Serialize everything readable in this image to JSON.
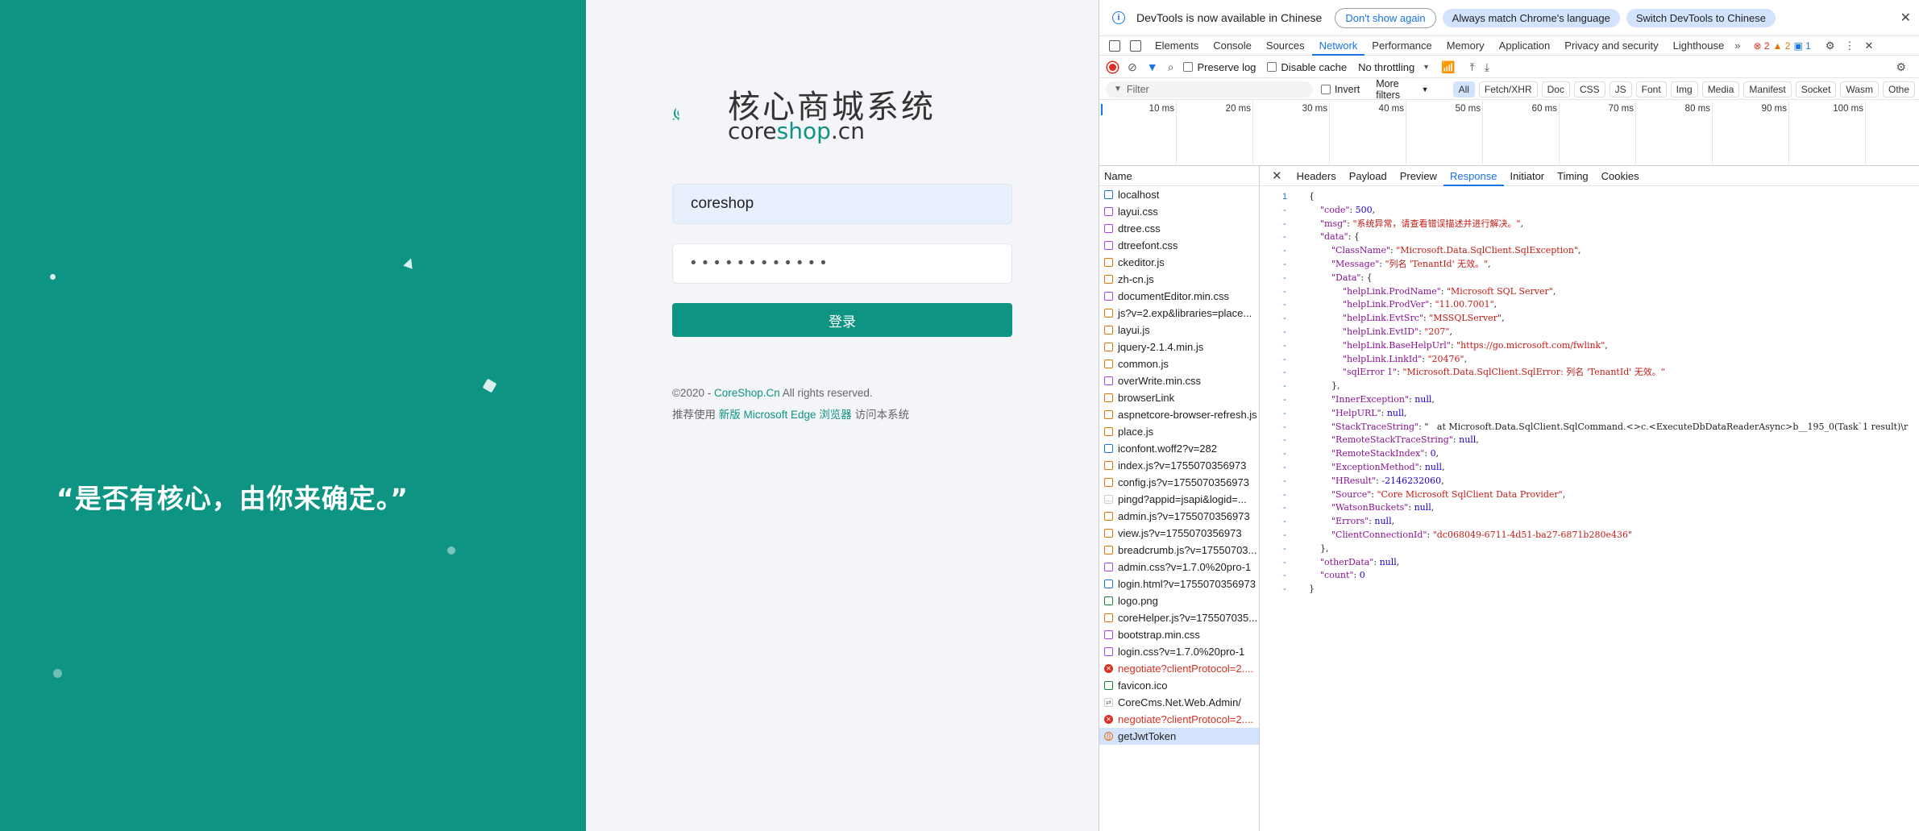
{
  "left": {
    "slogan": "“是否有核心，由你来确定。”"
  },
  "login": {
    "logo_cn": "核心商城系统",
    "logo_en_a": "core",
    "logo_en_b": "shop",
    "logo_en_c": ".cn",
    "username": "coreshop",
    "password_mask": "••••••••••••",
    "button": "登录",
    "copyright_a": "©2020 - ",
    "copyright_link": "CoreShop.Cn",
    "copyright_b": " All rights reserved.",
    "recommend_a": "推荐使用 ",
    "recommend_link": "新版 Microsoft Edge 浏览器",
    "recommend_b": " 访问本系统"
  },
  "devtools": {
    "info_text": "DevTools is now available in Chinese",
    "dont_show": "Don't show again",
    "match_lang": "Always match Chrome's language",
    "switch_lang": "Switch DevTools to Chinese",
    "tabs": [
      "Elements",
      "Console",
      "Sources",
      "Network",
      "Performance",
      "Memory",
      "Application",
      "Privacy and security",
      "Lighthouse"
    ],
    "errors": "2",
    "warnings": "2",
    "messages": "1",
    "preserve_log": "Preserve log",
    "disable_cache": "Disable cache",
    "throttling": "No throttling",
    "filter_placeholder": "Filter",
    "invert": "Invert",
    "more_filters": "More filters",
    "filter_types": [
      "All",
      "Fetch/XHR",
      "Doc",
      "CSS",
      "JS",
      "Font",
      "Img",
      "Media",
      "Manifest",
      "Socket",
      "Wasm",
      "Othe"
    ],
    "timeline_ticks": [
      "10 ms",
      "20 ms",
      "30 ms",
      "40 ms",
      "50 ms",
      "60 ms",
      "70 ms",
      "80 ms",
      "90 ms",
      "100 ms"
    ],
    "name_header": "Name",
    "requests": [
      {
        "name": "localhost",
        "type": "doc"
      },
      {
        "name": "layui.css",
        "type": "css"
      },
      {
        "name": "dtree.css",
        "type": "css"
      },
      {
        "name": "dtreefont.css",
        "type": "css"
      },
      {
        "name": "ckeditor.js",
        "type": "js"
      },
      {
        "name": "zh-cn.js",
        "type": "js"
      },
      {
        "name": "documentEditor.min.css",
        "type": "css"
      },
      {
        "name": "js?v=2.exp&libraries=place...",
        "type": "js"
      },
      {
        "name": "layui.js",
        "type": "js"
      },
      {
        "name": "jquery-2.1.4.min.js",
        "type": "js"
      },
      {
        "name": "common.js",
        "type": "js"
      },
      {
        "name": "overWrite.min.css",
        "type": "css"
      },
      {
        "name": "browserLink",
        "type": "js"
      },
      {
        "name": "aspnetcore-browser-refresh.js",
        "type": "js"
      },
      {
        "name": "place.js",
        "type": "js"
      },
      {
        "name": "iconfont.woff2?v=282",
        "type": "font"
      },
      {
        "name": "index.js?v=1755070356973",
        "type": "js"
      },
      {
        "name": "config.js?v=1755070356973",
        "type": "js"
      },
      {
        "name": "pingd?appid=jsapi&logid=...",
        "type": "other"
      },
      {
        "name": "admin.js?v=1755070356973",
        "type": "js"
      },
      {
        "name": "view.js?v=1755070356973",
        "type": "js"
      },
      {
        "name": "breadcrumb.js?v=17550703...",
        "type": "js"
      },
      {
        "name": "admin.css?v=1.7.0%20pro-1",
        "type": "css"
      },
      {
        "name": "login.html?v=1755070356973",
        "type": "doc"
      },
      {
        "name": "logo.png",
        "type": "img"
      },
      {
        "name": "coreHelper.js?v=175507035...",
        "type": "js"
      },
      {
        "name": "bootstrap.min.css",
        "type": "css"
      },
      {
        "name": "login.css?v=1.7.0%20pro-1",
        "type": "css"
      },
      {
        "name": "negotiate?clientProtocol=2....",
        "type": "error"
      },
      {
        "name": "favicon.ico",
        "type": "img"
      },
      {
        "name": "CoreCms.Net.Web.Admin/",
        "type": "redirect"
      },
      {
        "name": "negotiate?clientProtocol=2....",
        "type": "error"
      },
      {
        "name": "getJwtToken",
        "type": "xhr"
      }
    ],
    "detail_tabs": [
      "Headers",
      "Payload",
      "Preview",
      "Response",
      "Initiator",
      "Timing",
      "Cookies"
    ],
    "response_lines": [
      {
        "g": "1",
        "t": "{"
      },
      {
        "g": "-",
        "t": "    \"code\": 500,"
      },
      {
        "g": "-",
        "t": "    \"msg\": \"系统异常，请查看错误描述并进行解决。\","
      },
      {
        "g": "-",
        "t": "    \"data\": {"
      },
      {
        "g": "-",
        "t": "        \"ClassName\": \"Microsoft.Data.SqlClient.SqlException\","
      },
      {
        "g": "-",
        "t": "        \"Message\": \"列名 'TenantId' 无效。\","
      },
      {
        "g": "-",
        "t": "        \"Data\": {"
      },
      {
        "g": "-",
        "t": "            \"helpLink.ProdName\": \"Microsoft SQL Server\","
      },
      {
        "g": "-",
        "t": "            \"helpLink.ProdVer\": \"11.00.7001\","
      },
      {
        "g": "-",
        "t": "            \"helpLink.EvtSrc\": \"MSSQLServer\","
      },
      {
        "g": "-",
        "t": "            \"helpLink.EvtID\": \"207\","
      },
      {
        "g": "-",
        "t": "            \"helpLink.BaseHelpUrl\": \"https://go.microsoft.com/fwlink\","
      },
      {
        "g": "-",
        "t": "            \"helpLink.LinkId\": \"20476\","
      },
      {
        "g": "-",
        "t": "            \"sqlError 1\": \"Microsoft.Data.SqlClient.SqlError: 列名 'TenantId' 无效。\""
      },
      {
        "g": "-",
        "t": "        },"
      },
      {
        "g": "-",
        "t": "        \"InnerException\": null,"
      },
      {
        "g": "-",
        "t": "        \"HelpURL\": null,"
      },
      {
        "g": "-",
        "t": "        \"StackTraceString\": \"   at Microsoft.Data.SqlClient.SqlCommand.<>c.<ExecuteDbDataReaderAsync>b__195_0(Task`1 result)\\r"
      },
      {
        "g": "-",
        "t": "        \"RemoteStackTraceString\": null,"
      },
      {
        "g": "-",
        "t": "        \"RemoteStackIndex\": 0,"
      },
      {
        "g": "-",
        "t": "        \"ExceptionMethod\": null,"
      },
      {
        "g": "-",
        "t": "        \"HResult\": -2146232060,"
      },
      {
        "g": "-",
        "t": "        \"Source\": \"Core Microsoft SqlClient Data Provider\","
      },
      {
        "g": "-",
        "t": "        \"WatsonBuckets\": null,"
      },
      {
        "g": "-",
        "t": "        \"Errors\": null,"
      },
      {
        "g": "-",
        "t": "        \"ClientConnectionId\": \"dc068049-6711-4d51-ba27-6871b280e436\""
      },
      {
        "g": "-",
        "t": "    },"
      },
      {
        "g": "-",
        "t": "    \"otherData\": null,"
      },
      {
        "g": "-",
        "t": "    \"count\": 0"
      },
      {
        "g": "-",
        "t": "}"
      }
    ]
  }
}
